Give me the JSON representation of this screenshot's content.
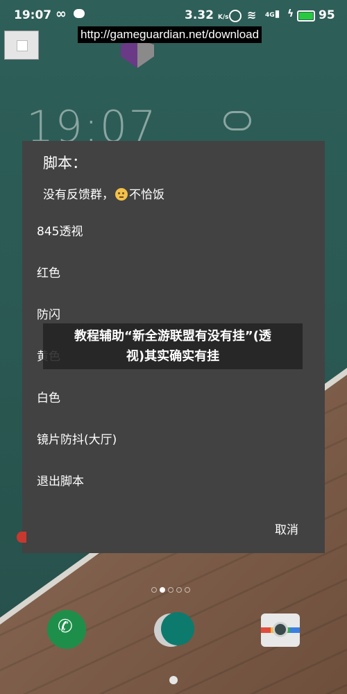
{
  "status_bar": {
    "time": "19:07",
    "speed_value": "3.32",
    "speed_unit": "K/s",
    "signal_label": "4G",
    "battery": "95",
    "icons": [
      "infinity-icon",
      "chat-icon",
      "alarm-icon",
      "wifi-icon",
      "signal-icon",
      "charging-icon",
      "battery-icon"
    ],
    "battery_color": "#27c93f"
  },
  "overlay": {
    "url": "http://gameguardian.net/download",
    "stop_icon": "stop-square-icon"
  },
  "background": {
    "clock": "19:07",
    "weather_icon": "cloud-icon"
  },
  "dialog": {
    "title": "脚本：",
    "message_before": "没有反馈群，",
    "message_after": "不恰饭",
    "message_emoji": "face-emoji-icon",
    "items": [
      "845透视",
      "红色",
      "防闪",
      "黄色",
      "白色",
      "镜片防抖(大厅)",
      "退出脚本"
    ],
    "cancel": "取消",
    "bg_color": "#424242"
  },
  "caption": {
    "line1": "教程辅助“新全游联盟有没有挂”(透",
    "line2": "视)其实确实有挂"
  },
  "dock": {
    "icons": [
      "phone-icon",
      "browser-icon",
      "camera-icon"
    ],
    "page_count": 5,
    "active_page": 2
  }
}
